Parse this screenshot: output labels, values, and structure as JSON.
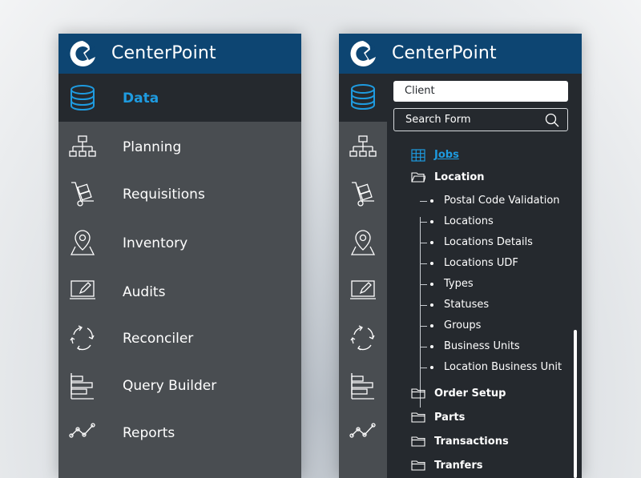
{
  "brand": {
    "name": "CenterPoint"
  },
  "colors": {
    "brand_bar": "#0d4572",
    "accent": "#1e9be0",
    "panel": "#494d51",
    "panel_dark": "#25292e"
  },
  "left_menu": {
    "items": [
      {
        "label": "Data",
        "icon": "database-icon",
        "active": true
      },
      {
        "label": "Planning",
        "icon": "org-chart-icon"
      },
      {
        "label": "Requisitions",
        "icon": "hand-truck-icon"
      },
      {
        "label": "Inventory",
        "icon": "map-pin-icon"
      },
      {
        "label": "Audits",
        "icon": "laptop-edit-icon"
      },
      {
        "label": "Reconciler",
        "icon": "recycle-icon"
      },
      {
        "label": "Query Builder",
        "icon": "bar-chart-icon"
      },
      {
        "label": "Reports",
        "icon": "line-chart-icon"
      }
    ]
  },
  "right_panel": {
    "client_value": "Client",
    "search_placeholder": "Search Form",
    "tree": {
      "jobs": "Jobs",
      "location": "Location",
      "location_children": [
        "Postal Code Validation",
        "Locations",
        "Locations Details",
        "Locations UDF",
        "Types",
        "Statuses",
        "Groups",
        "Business Units",
        "Location Business Unit"
      ],
      "folders": [
        "Order Setup",
        "Parts",
        "Transactions",
        "Tranfers"
      ]
    }
  }
}
